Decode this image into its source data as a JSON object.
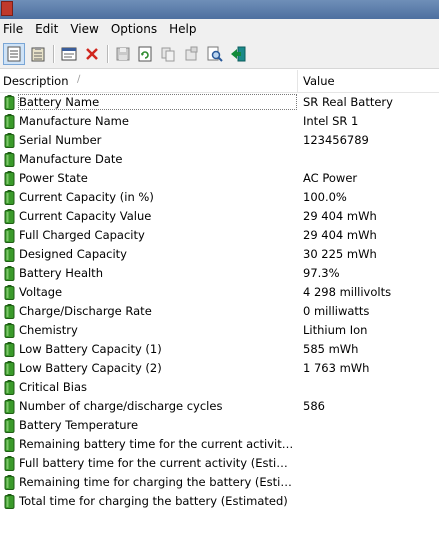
{
  "menu": [
    "File",
    "Edit",
    "View",
    "Options",
    "Help"
  ],
  "toolbar": {
    "buttons": [
      {
        "icon": "properties-icon",
        "name": "properties-button"
      },
      {
        "icon": "save-list-icon",
        "name": "save-list-button"
      },
      {
        "icon": "html-report-icon",
        "name": "html-report-button"
      },
      {
        "icon": "delete-icon",
        "name": "delete-button"
      },
      {
        "icon": "save-icon",
        "name": "save-button"
      },
      {
        "icon": "refresh-icon",
        "name": "refresh-button"
      },
      {
        "icon": "copy-icon",
        "name": "copy-button"
      },
      {
        "icon": "properties-dialog-icon",
        "name": "properties-dialog-button"
      },
      {
        "icon": "find-icon",
        "name": "find-button"
      },
      {
        "icon": "exit-icon",
        "name": "exit-button"
      }
    ]
  },
  "columns": {
    "description": "Description",
    "value": "Value"
  },
  "colors": {
    "battery": "#3a9a2a",
    "battery_dark": "#1f5e14",
    "accent": "#cfe3f7"
  },
  "rows": [
    {
      "desc": "Battery Name",
      "value": "SR Real Battery"
    },
    {
      "desc": "Manufacture Name",
      "value": "Intel SR 1"
    },
    {
      "desc": "Serial Number",
      "value": "123456789"
    },
    {
      "desc": "Manufacture Date",
      "value": ""
    },
    {
      "desc": "Power State",
      "value": "AC Power"
    },
    {
      "desc": "Current Capacity (in %)",
      "value": "100.0%"
    },
    {
      "desc": "Current Capacity Value",
      "value": "29 404 mWh"
    },
    {
      "desc": "Full Charged Capacity",
      "value": "29 404 mWh"
    },
    {
      "desc": "Designed Capacity",
      "value": "30 225 mWh"
    },
    {
      "desc": "Battery Health",
      "value": "97.3%"
    },
    {
      "desc": "Voltage",
      "value": "4 298 millivolts"
    },
    {
      "desc": "Charge/Discharge Rate",
      "value": "0 milliwatts"
    },
    {
      "desc": "Chemistry",
      "value": "Lithium Ion"
    },
    {
      "desc": "Low Battery Capacity (1)",
      "value": "585 mWh"
    },
    {
      "desc": "Low Battery Capacity (2)",
      "value": "1 763 mWh"
    },
    {
      "desc": "Critical Bias",
      "value": ""
    },
    {
      "desc": "Number of charge/discharge cycles",
      "value": "586"
    },
    {
      "desc": "Battery Temperature",
      "value": ""
    },
    {
      "desc": "Remaining battery time for the current activity (Estimated)",
      "value": ""
    },
    {
      "desc": "Full battery time for the current activity (Estimated)",
      "value": ""
    },
    {
      "desc": "Remaining time for charging the battery (Estimated)",
      "value": ""
    },
    {
      "desc": "Total  time for charging the battery (Estimated)",
      "value": ""
    }
  ]
}
